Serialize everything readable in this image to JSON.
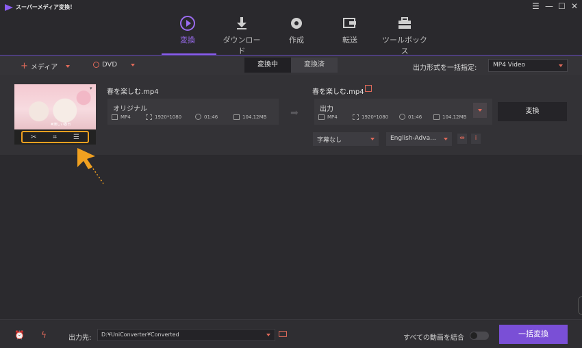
{
  "app": {
    "title": "スーパーメディア変換！"
  },
  "window_controls": [
    "☰",
    "—",
    "☐",
    "✕"
  ],
  "nav": [
    {
      "label": "変換",
      "icon": "convert-icon",
      "active": true
    },
    {
      "label": "ダウンロード",
      "icon": "download-icon",
      "active": false
    },
    {
      "label": "作成",
      "icon": "disc-icon",
      "active": false
    },
    {
      "label": "転送",
      "icon": "transfer-icon",
      "active": false
    },
    {
      "label": "ツールボックス",
      "icon": "toolbox-icon",
      "active": false
    }
  ],
  "toolbar": {
    "add_media": "メディア",
    "add_media_prefix": "+",
    "dvd": "DVD",
    "tab_converting": "変換中",
    "tab_converted": "変換済",
    "format_label": "出力形式を一括指定:",
    "format_value": "MP4 Video"
  },
  "file": {
    "thumb_caption": "#楽しい春日",
    "source_name": "春を楽しむ.mp4",
    "source_title": "オリジナル",
    "source_format": "MP4",
    "source_resolution": "1920*1080",
    "source_duration": "01:46",
    "source_size": "104.12MB",
    "output_name": "春を楽しむ.mp4",
    "output_title": "出力",
    "output_format": "MP4",
    "output_resolution": "1920*1080",
    "output_duration": "01:46",
    "output_size": "104.12MB",
    "subtitle_value": "字幕なし",
    "audio_value": "English-Adva...",
    "convert_label": "変換"
  },
  "bottom": {
    "output_label": "出力先:",
    "output_path": "D:¥UniConverter¥Converted",
    "merge_label": "すべての動画を結合",
    "batch_convert": "一括変換"
  },
  "colors": {
    "accent_purple": "#7a4fd6",
    "accent_red": "#e06a5a",
    "highlight_orange": "#f0a020"
  }
}
